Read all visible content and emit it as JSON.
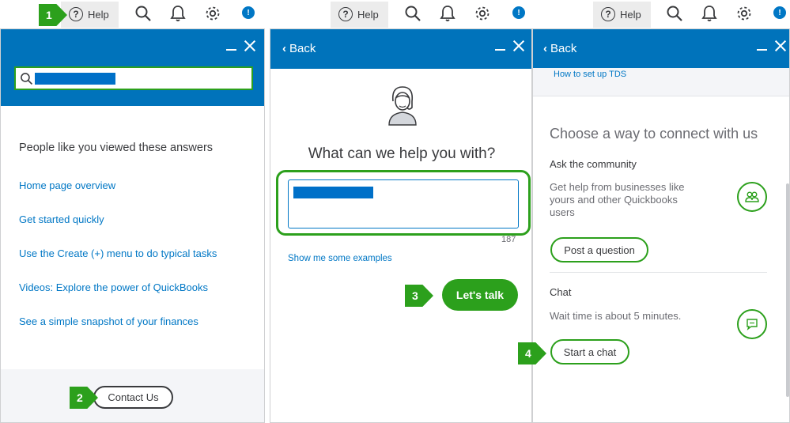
{
  "topbar": {
    "help_label": "Help",
    "notif_text": "!"
  },
  "panel1": {
    "section_title": "People like you viewed these answers",
    "answers": [
      "Home page overview",
      "Get started quickly",
      "Use the Create (+) menu to do typical tasks",
      "Videos: Explore the power of QuickBooks",
      "See a simple snapshot of your finances"
    ],
    "contact_label": "Contact Us"
  },
  "panel2": {
    "back_label": "Back",
    "question": "What can we help you with?",
    "char_count": "187",
    "examples_link": "Show me some examples",
    "talk_label": "Let's talk"
  },
  "panel3": {
    "back_label": "Back",
    "tds_link": "How to set up TDS",
    "connect_title": "Choose a way to connect with us",
    "community_title": "Ask the community",
    "community_desc": "Get help from businesses like yours and other Quickbooks users",
    "post_label": "Post a question",
    "chat_title": "Chat",
    "chat_desc": "Wait time is about 5 minutes.",
    "start_chat_label": "Start a chat"
  },
  "callouts": [
    "1",
    "2",
    "3",
    "4"
  ],
  "colors": {
    "brand_blue": "#0073bb",
    "link_blue": "#0077c5",
    "accent_green": "#2ca01c",
    "redaction_blue": "#0070c8"
  }
}
